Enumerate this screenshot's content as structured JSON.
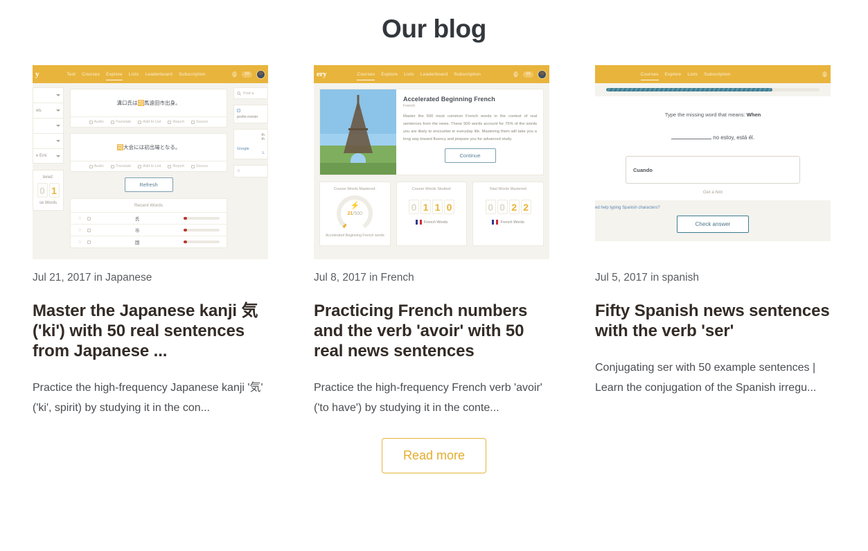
{
  "page": {
    "title": "Our blog"
  },
  "colors": {
    "accent_gold": "#e8b43c",
    "read_more_border": "#e5b33c",
    "title_text": "#332b26",
    "meta_text": "#595c60",
    "body_text": "#4a4d51",
    "teal": "#3d7c92",
    "app_bg": "#f4f3ee"
  },
  "posts": [
    {
      "meta": "Jul 21, 2017 in Japanese",
      "title": "Master the Japanese kanji 気 ('ki') with 50 real sentences from Japanese ...",
      "excerpt": "Practice the high-frequency Japanese kanji '気' ('ki', spirit) by studying it in the con..."
    },
    {
      "meta": "Jul 8, 2017 in French",
      "title": "Practicing French numbers and the verb 'avoir' with 50 real news sentences",
      "excerpt": "Practice the high-frequency French verb 'avoir' ('to have') by studying it in the conte..."
    },
    {
      "meta": "Jul 5, 2017 in spanish",
      "title": "Fifty Spanish news sentences with the verb 'ser'",
      "excerpt": "Conjugating ser with 50 example sentences | Learn the conjugation of the Spanish irregu..."
    }
  ],
  "thumb1": {
    "nav": {
      "links": [
        "Test",
        "Courses",
        "Explore",
        "Lists",
        "Leaderboard",
        "Subscription"
      ],
      "active": "Explore",
      "badge": "20"
    },
    "sidebar_left": {
      "dropdowns": [
        "",
        "els",
        "",
        "",
        "e Emi"
      ],
      "stat_label": "tered:",
      "digits": [
        "0",
        "1"
      ],
      "stat_footer": "se Words"
    },
    "sentences": [
      {
        "pre": "溝口氏は",
        "hl": "司",
        "post": "馬遠田市出身。"
      },
      {
        "pre": "",
        "hl": "司",
        "post": "大会には初出場となる。"
      }
    ],
    "actions": [
      "Audio",
      "Translate",
      "Add to List",
      "Report",
      "Source"
    ],
    "refresh_label": "Refresh",
    "recent_title": "Recent Words",
    "recent_words": [
      "氏",
      "市",
      "国"
    ],
    "sidebar_right": {
      "search_placeholder": "Find a",
      "tag": "prefix-nomin",
      "fragment_a": "th",
      "fragment_b": "th",
      "google": "Google",
      "link_l": "L"
    }
  },
  "thumb2": {
    "brand": "ery",
    "nav": {
      "links": [
        "Courses",
        "Explore",
        "Lists",
        "Leaderboard",
        "Subscription"
      ],
      "active": "Courses",
      "badge": "55"
    },
    "course": {
      "title": "Accelerated Beginning French",
      "subtitle": "French",
      "description": "Master the 500 most common French words in the context of real sentences from the news. These 500 words account for 75% of the words you are likely to encounter in everyday life. Mastering them will take you a long way toward fluency and prepare you for advanced study.",
      "continue_label": "Continue"
    },
    "stats": [
      {
        "label": "Course Words Mastered:",
        "value": "21",
        "total": "/500",
        "footer": "Accelerated Beginning French words"
      },
      {
        "label": "Course Words Studied:",
        "digits": [
          "0",
          "1",
          "1",
          "0"
        ],
        "footer": "French Words"
      },
      {
        "label": "Total Words Mastered:",
        "digits": [
          "0",
          "0",
          "2",
          "2"
        ],
        "footer": "French Words"
      }
    ]
  },
  "thumb3": {
    "nav": {
      "links": [
        "Courses",
        "Explore",
        "Lists",
        "Subscription"
      ],
      "active": "Courses"
    },
    "prompt_prefix": "Type the missing word that means:",
    "prompt_word": "When",
    "sentence_after": " no estoy, está él.",
    "answer_value": "Cuando",
    "hint_label": "Get a hint",
    "help_label": "ed help typing Spanish characters?",
    "check_label": "Check answer"
  },
  "read_more": {
    "label": "Read more"
  }
}
